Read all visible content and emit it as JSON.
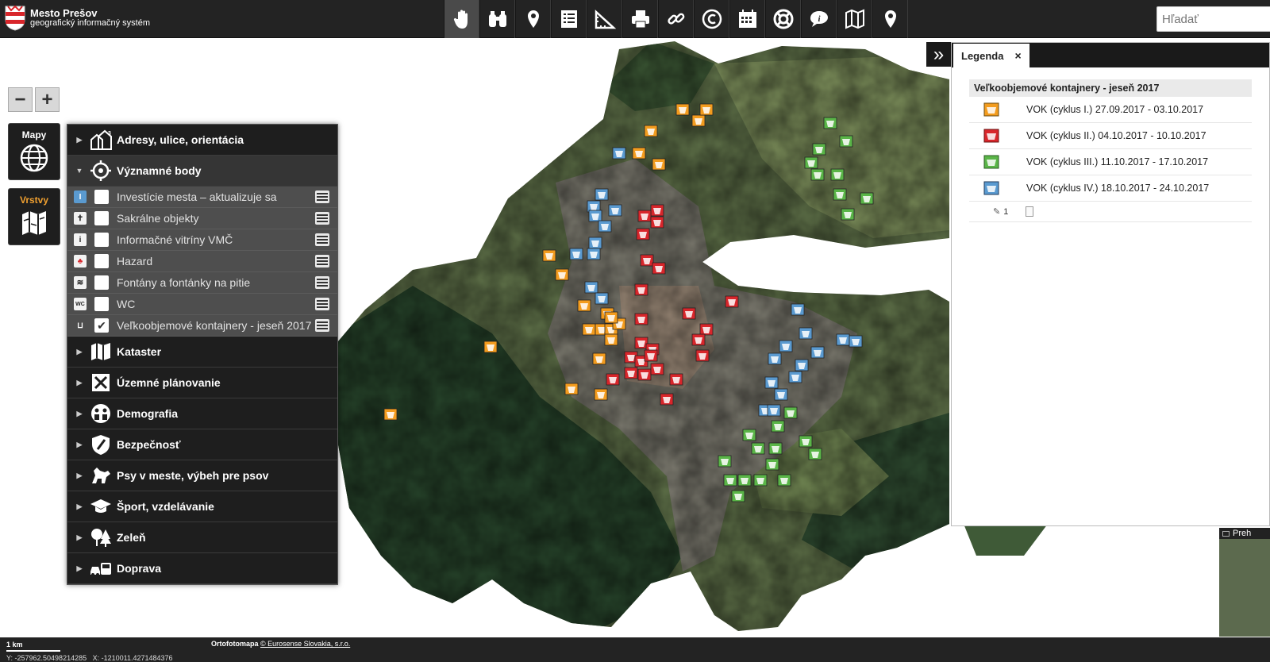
{
  "app": {
    "title": "Mesto Prešov",
    "subtitle": "geografický informačný systém"
  },
  "toolbar": {
    "tools": [
      {
        "icon": "hand-pan-icon",
        "active": true
      },
      {
        "icon": "binoculars-icon"
      },
      {
        "icon": "map-pin-icon"
      },
      {
        "icon": "list-icon"
      },
      {
        "icon": "ruler-icon"
      },
      {
        "icon": "printer-icon"
      },
      {
        "icon": "link-icon"
      },
      {
        "icon": "copyright-icon"
      },
      {
        "icon": "calendar-icon"
      },
      {
        "icon": "lifebuoy-icon"
      },
      {
        "icon": "info-bubble-icon"
      },
      {
        "icon": "map-book-icon"
      },
      {
        "icon": "location-pin-icon"
      }
    ],
    "search_placeholder": "Hľadať"
  },
  "zoom": {
    "out": "−",
    "in": "+"
  },
  "side": {
    "maps_label": "Mapy",
    "layers_label": "Vrstvy"
  },
  "layers": {
    "groups": [
      {
        "label": "Adresy, ulice, orientácia",
        "open": false
      },
      {
        "label": "Významné body",
        "open": true
      },
      {
        "label": "Kataster",
        "open": false
      },
      {
        "label": "Územné plánovanie",
        "open": false
      },
      {
        "label": "Demografia",
        "open": false
      },
      {
        "label": "Bezpečnosť",
        "open": false
      },
      {
        "label": "Psy v meste, výbeh pre psov",
        "open": false
      },
      {
        "label": "Šport, vzdelávanie",
        "open": false
      },
      {
        "label": "Zeleň",
        "open": false
      },
      {
        "label": "Doprava",
        "open": false
      }
    ],
    "sublayers": [
      {
        "label": "Investície mesta – aktualizuje sa",
        "checked": false,
        "icon": "I"
      },
      {
        "label": "Sakrálne objekty",
        "checked": false,
        "icon": "✝"
      },
      {
        "label": "Informačné vitríny VMČ",
        "checked": false,
        "icon": "i"
      },
      {
        "label": "Hazard",
        "checked": false,
        "icon": "♣"
      },
      {
        "label": "Fontány a fontánky na pitie",
        "checked": false,
        "icon": "≋"
      },
      {
        "label": "WC",
        "checked": false,
        "icon": "WC"
      },
      {
        "label": "Veľkoobjemové kontajnery - jeseň 2017",
        "checked": true,
        "icon": "⊔"
      }
    ]
  },
  "legend": {
    "tab_label": "Legenda",
    "close": "×",
    "toggle": "»",
    "title": "Veľkoobjemové kontajnery - jeseň 2017",
    "items": [
      {
        "label": "VOK (cyklus I.) 27.09.2017 - 03.10.2017",
        "color": "#f39c1e"
      },
      {
        "label": "VOK (cyklus II.) 04.10.2017 - 10.10.2017",
        "color": "#d8262b"
      },
      {
        "label": "VOK (cyklus III.) 11.10.2017 - 17.10.2017",
        "color": "#5ab548"
      },
      {
        "label": "VOK (cyklus IV.) 18.10.2017 - 24.10.2017",
        "color": "#5a9ad0"
      }
    ],
    "footer_count": "1"
  },
  "overview": {
    "label": "Preh"
  },
  "bottom": {
    "scale_label": "1 km",
    "attribution_bold": "Ortofotomapa",
    "attribution_link": "© Eurosense Slovakia, s.r.o.",
    "coords": "Y: -257962.50498214285   X: -1210011.4271484376"
  },
  "markers": {
    "colors": {
      "orange": "#f39c1e",
      "red": "#d8262b",
      "green": "#5ab548",
      "blue": "#5a9ad0"
    }
  }
}
